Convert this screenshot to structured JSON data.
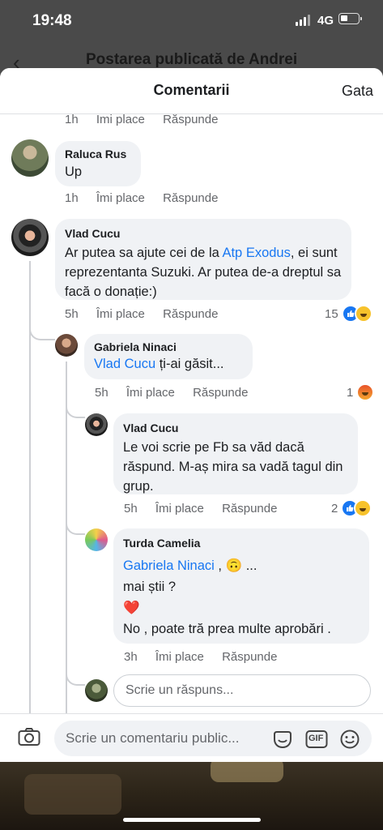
{
  "status": {
    "time": "19:48",
    "network": "4G"
  },
  "background": {
    "title": "Postarea publicată de Andrei"
  },
  "sheet": {
    "title": "Comentarii",
    "done": "Gata"
  },
  "labels": {
    "like": "Îmi place",
    "reply": "Răspunde"
  },
  "top_meta": {
    "time": "1h"
  },
  "comments": [
    {
      "author": "Raluca Rus",
      "text": "Up",
      "time": "1h"
    },
    {
      "author": "Vlad Cucu",
      "text_before": "Ar putea sa ajute cei de la ",
      "link": "Atp Exodus",
      "text_after": ", ei sunt reprezentanta Suzuki. Ar putea de-a dreptul sa facă o donație:)",
      "time": "5h",
      "reaction_count": "15"
    },
    {
      "author": "Gabriela Ninaci",
      "mention": "Vlad Cucu",
      "text": " ți-ai găsit...",
      "time": "5h",
      "reaction_count": "1"
    },
    {
      "author": "Vlad Cucu",
      "text": "Le voi scrie pe Fb sa văd dacă răspund. M-aș mira sa vadă tagul din grup.",
      "time": "5h",
      "reaction_count": "2"
    },
    {
      "author": "Turda Camelia",
      "mention": "Gabriela Ninaci",
      "line1_after": " , 🙃 ...",
      "line2": "mai știi ?",
      "line3": "❤️",
      "line4": "No , poate tră prea multe aprobări .",
      "time": "3h"
    }
  ],
  "reply_placeholder": "Scrie un răspuns...",
  "composer": {
    "placeholder": "Scrie un comentariu public...",
    "gif": "GIF"
  },
  "icons": [
    "back-icon",
    "camera-icon",
    "sticker-icon",
    "gif-icon",
    "emoji-icon",
    "like-reaction-icon",
    "haha-reaction-icon",
    "angry-reaction-icon"
  ]
}
